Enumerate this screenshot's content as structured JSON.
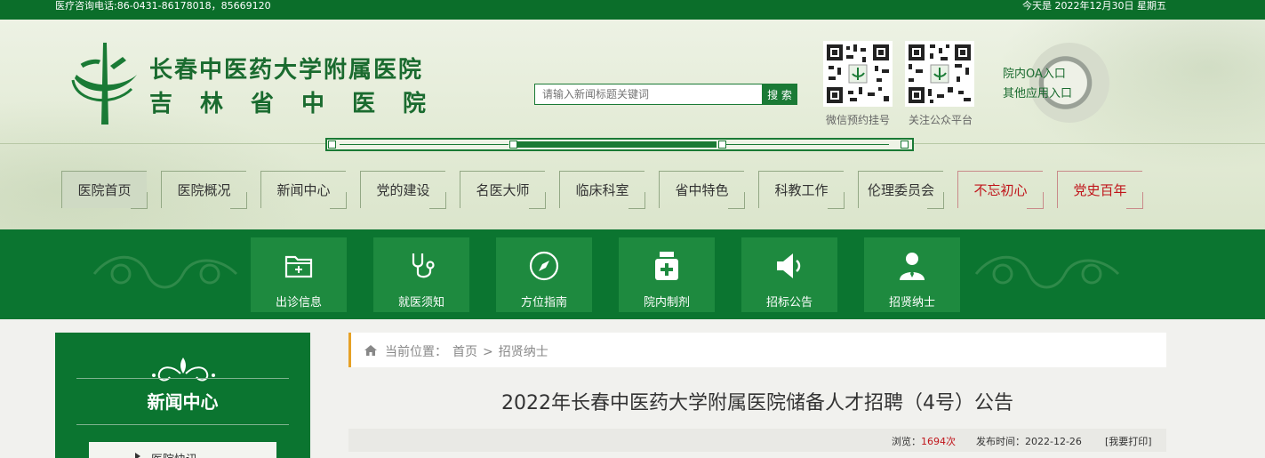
{
  "topbar": {
    "phone": "医疗咨询电话:86-0431-86178018，85669120",
    "date": "今天是 2022年12月30日 星期五"
  },
  "header": {
    "name_line1": "长春中医药大学附属医院",
    "name_line2": "吉林省中医院",
    "search_placeholder": "请输入新闻标题关键词",
    "search_button": "搜 索",
    "qr_wechat_caption": "微信预约挂号",
    "qr_official_caption": "关注公众平台",
    "oa_link": "院内OA入口",
    "other_link": "其他应用入口"
  },
  "nav": [
    {
      "label": "医院首页"
    },
    {
      "label": "医院概况"
    },
    {
      "label": "新闻中心"
    },
    {
      "label": "党的建设"
    },
    {
      "label": "名医大师"
    },
    {
      "label": "临床科室"
    },
    {
      "label": "省中特色"
    },
    {
      "label": "科教工作"
    },
    {
      "label": "伦理委员会"
    },
    {
      "label": "不忘初心"
    },
    {
      "label": "党史百年"
    }
  ],
  "quick_links": [
    {
      "label": "出诊信息",
      "icon": "folder-plus-icon"
    },
    {
      "label": "就医须知",
      "icon": "stethoscope-icon"
    },
    {
      "label": "方位指南",
      "icon": "compass-icon"
    },
    {
      "label": "院内制剂",
      "icon": "medicine-bottle-icon"
    },
    {
      "label": "招标公告",
      "icon": "speaker-icon"
    },
    {
      "label": "招贤纳士",
      "icon": "user-icon"
    }
  ],
  "sidebar": {
    "title": "新闻中心",
    "first_item": "医院快讯"
  },
  "breadcrumb": {
    "prefix": "当前位置：",
    "home": "首页",
    "sep": ">",
    "current": "招贤纳士"
  },
  "article": {
    "title": "2022年长春中医药大学附属医院储备人才招聘（4号）公告",
    "views_label": "浏览：",
    "views": "1694次",
    "publish_label": "发布时间：",
    "publish_date": "2022-12-26",
    "print": "[我要打印]"
  },
  "colors": {
    "primary_green": "#0b7530",
    "accent_red": "#c0141a",
    "crumb_accent": "#e6a126"
  }
}
